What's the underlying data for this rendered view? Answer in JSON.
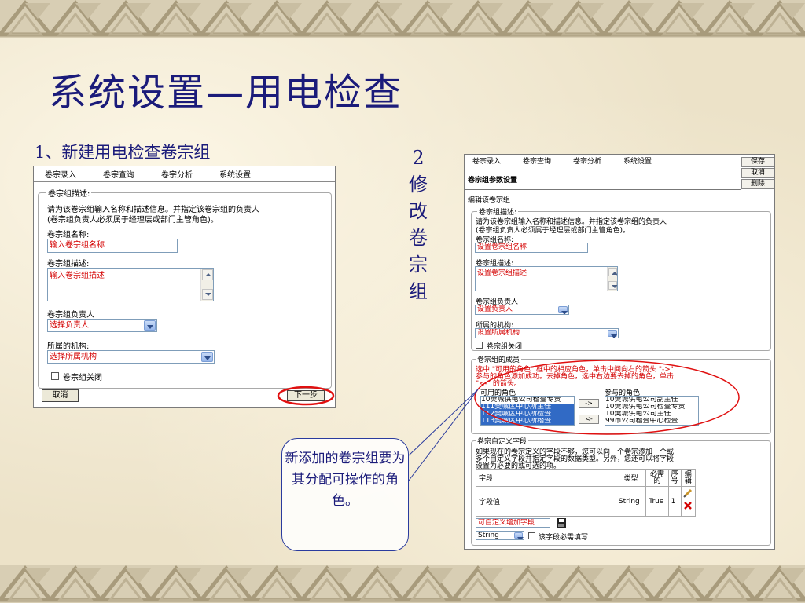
{
  "slide": {
    "title": "系统设置—用电检查",
    "step1": "1、新建用电检查卷宗组",
    "step2_chars": [
      "2",
      "修",
      "改",
      "卷",
      "宗",
      "组"
    ],
    "callout": "新添加的卷宗组要为其分配可操作的角色。"
  },
  "menu": [
    "卷宗录入",
    "卷宗查询",
    "卷宗分析",
    "系统设置"
  ],
  "left_window": {
    "fieldset_legend": "卷宗组描述:",
    "instructions_1": "请为该卷宗组输入名称和描述信息。并指定该卷宗组的负责人",
    "instructions_2": "(卷宗组负责人必须属于经理层或部门主管角色)。",
    "name_label": "卷宗组名称:",
    "name_value": "输入卷宗组名称",
    "desc_label": "卷宗组描述:",
    "desc_value": "输入卷宗组描述",
    "owner_label": "卷宗组负责人",
    "owner_value": "选择负责人",
    "org_label": "所属的机构:",
    "org_value": "选择所属机构",
    "close_label": "卷宗组关闭",
    "cancel_label": "取消",
    "next_label": "下一步"
  },
  "right_window": {
    "save_label": "保存",
    "cancel_label": "取消",
    "delete_label": "删除",
    "header_title": "卷宗组参数设置",
    "edit_label": "编辑该卷宗组",
    "fieldset_legend": "卷宗组描述:",
    "instructions_1": "请为该卷宗组输入名称和描述信息。并指定该卷宗组的负责人",
    "instructions_2": "(卷宗组负责人必须属于经理层或部门主管角色)。",
    "name_label": "卷宗组名称:",
    "name_value": "设置卷宗组名称",
    "desc_label": "卷宗组描述:",
    "desc_value": "设置卷宗组描述",
    "owner_label": "卷宗组负责人",
    "owner_value": "设置负责人",
    "org_label": "所属的机构:",
    "org_value": "设置所属机构",
    "close_label": "卷宗组关闭",
    "members_legend": "卷宗组的成员",
    "members_note_1": "选中 \"可用的角色\" 框中的相应角色，单击中间向右的箭头 \"->\"",
    "members_note_2": "参与的角色添加成功。去掉角色，选中右边要去掉的角色，单击",
    "members_note_3": "\"<-\" 的箭头。",
    "available_label": "可用的角色",
    "participating_label": "参与的角色",
    "available_roles": [
      "10樊城供电公司稽查专责",
      "111樊城区中心所主任",
      "112樊城区中心所检查",
      "113樊城区中心所稽查"
    ],
    "participating_roles": [
      "10樊城供电公司副主任",
      "10樊城供电公司检查专责",
      "10樊城供电公司主任",
      "99市公司稽查中心检查"
    ],
    "add_arrow": "->",
    "remove_arrow": "<-",
    "custom_legend": "卷宗自定义字段",
    "custom_note_1": "如果现在的卷宗定义的字段不够，您可以向一个卷宗添加一个或",
    "custom_note_2": "多个自定义字段并指定字段的数据类型。另外，您还可以将字段",
    "custom_note_3": "设置为必要的或可选的项。",
    "table_headers": [
      "字段",
      "类型",
      "必需的",
      "序号",
      "编辑"
    ],
    "table_row": [
      "字段值",
      "String",
      "True",
      "1"
    ],
    "add_field_value": "可自定义增加字段",
    "type_value": "String",
    "required_label": "该字段必需填写"
  }
}
